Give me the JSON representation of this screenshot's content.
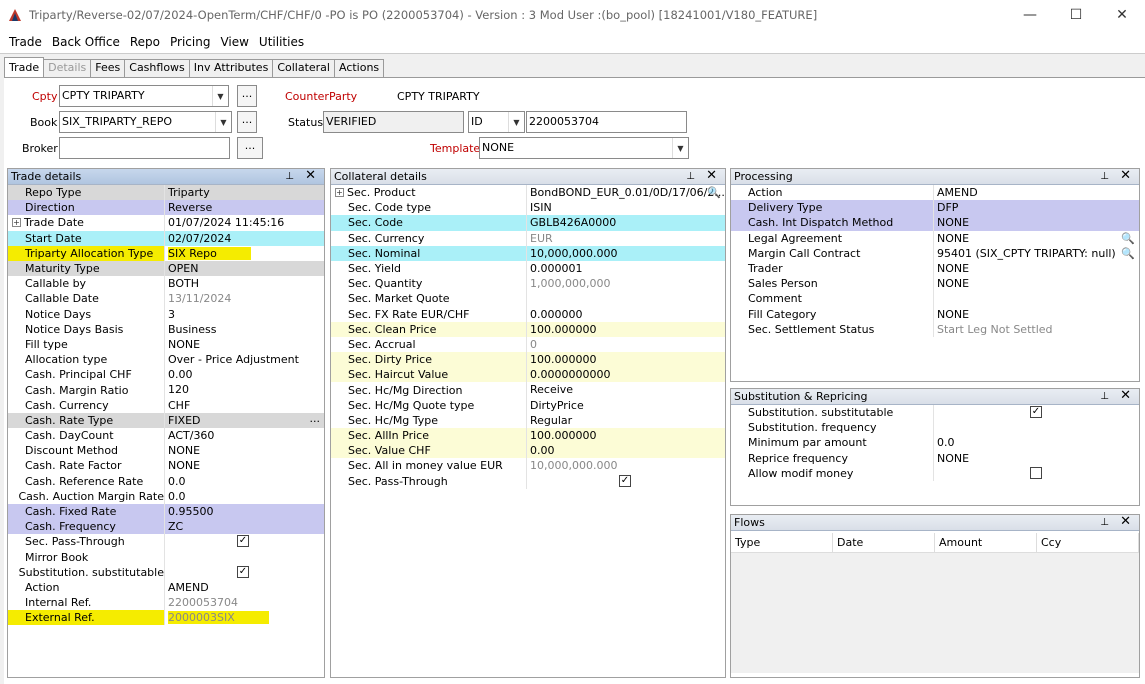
{
  "window": {
    "title": "Triparty/Reverse-02/07/2024-OpenTerm/CHF/CHF/0  -PO is PO  (2200053704) - Version : 3 Mod User :(bo_pool)  [18241001/V180_FEATURE]",
    "minimize": "—",
    "maximize": "☐",
    "close": "✕"
  },
  "menu": [
    "Trade",
    "Back Office",
    "Repo",
    "Pricing",
    "View",
    "Utilities"
  ],
  "tabs": [
    "Trade",
    "Details",
    "Fees",
    "Cashflows",
    "Inv Attributes",
    "Collateral",
    "Actions"
  ],
  "header": {
    "cpty_label": "Cpty",
    "cpty_value": "CPTY TRIPARTY",
    "counterparty_label": "CounterParty",
    "counterparty_value": "CPTY TRIPARTY",
    "book_label": "Book",
    "book_value": "SIX_TRIPARTY_REPO",
    "status_label": "Status",
    "status_value": "VERIFIED",
    "id_type": "ID",
    "id_value": "2200053704",
    "broker_label": "Broker",
    "broker_value": "",
    "template_label": "Template",
    "template_value": "NONE",
    "dots": "..."
  },
  "trade_details": {
    "title": "Trade details",
    "rows": [
      {
        "k": "Repo Type",
        "v": "Triparty",
        "style": "gry"
      },
      {
        "k": "Direction",
        "v": "Reverse",
        "style": "lav"
      },
      {
        "k": "Trade Date",
        "v": "01/07/2024 11:45:16",
        "style": "",
        "exp": true
      },
      {
        "k": "Start Date",
        "v": "02/07/2024",
        "style": "cyan"
      },
      {
        "k": "Triparty Allocation Type",
        "v": "SIX Repo",
        "style": "yhl"
      },
      {
        "k": "Maturity Type",
        "v": "OPEN",
        "style": "gry"
      },
      {
        "k": "Callable by",
        "v": "BOTH",
        "style": ""
      },
      {
        "k": "Callable Date",
        "v": "13/11/2024",
        "style": "",
        "dim": true
      },
      {
        "k": "Notice Days",
        "v": "3",
        "style": ""
      },
      {
        "k": "Notice Days Basis",
        "v": "Business",
        "style": ""
      },
      {
        "k": "Fill type",
        "v": "NONE",
        "style": ""
      },
      {
        "k": "Allocation type",
        "v": "Over - Price Adjustment",
        "style": ""
      },
      {
        "k": "Cash. Principal CHF",
        "v": "0.00",
        "style": ""
      },
      {
        "k": "Cash. Margin Ratio",
        "v": "120",
        "style": ""
      },
      {
        "k": "Cash. Currency",
        "v": "CHF",
        "style": ""
      },
      {
        "k": "Cash. Rate Type",
        "v": "FIXED",
        "style": "gry",
        "ell": "..."
      },
      {
        "k": "Cash. DayCount",
        "v": "ACT/360",
        "style": ""
      },
      {
        "k": "Discount Method",
        "v": "NONE",
        "style": ""
      },
      {
        "k": "Cash. Rate Factor",
        "v": "NONE",
        "style": ""
      },
      {
        "k": "Cash. Reference Rate",
        "v": "0.0",
        "style": ""
      },
      {
        "k": "Cash. Auction Margin Rate",
        "v": "0.0",
        "style": ""
      },
      {
        "k": "Cash. Fixed Rate",
        "v": "0.95500",
        "style": "lav"
      },
      {
        "k": "Cash. Frequency",
        "v": "ZC",
        "style": "lav"
      },
      {
        "k": "Sec. Pass-Through",
        "v": "",
        "style": "",
        "chk": "checked"
      },
      {
        "k": "Mirror Book",
        "v": "",
        "style": ""
      },
      {
        "k": "Substitution. substitutable",
        "v": "",
        "style": "",
        "chk": "checked"
      },
      {
        "k": "Action",
        "v": "AMEND",
        "style": ""
      },
      {
        "k": "Internal Ref.",
        "v": "2200053704",
        "style": "",
        "dim": true
      },
      {
        "k": "External Ref.",
        "v": "2000003SIX",
        "style": "yhl",
        "dim": true
      }
    ]
  },
  "collateral_details": {
    "title": "Collateral details",
    "rows": [
      {
        "k": "Sec. Product",
        "v": "BondBOND_EUR_0.01/0D/17/06/2...",
        "style": "",
        "exp": true,
        "mag": true
      },
      {
        "k": "Sec. Code type",
        "v": "ISIN",
        "style": ""
      },
      {
        "k": "Sec. Code",
        "v": "GBLB426A0000",
        "style": "cyan"
      },
      {
        "k": "Sec. Currency",
        "v": "EUR",
        "style": "",
        "dim": true
      },
      {
        "k": "Sec. Nominal",
        "v": "10,000,000.000",
        "style": "cyan"
      },
      {
        "k": "Sec. Yield",
        "v": "0.000001",
        "style": ""
      },
      {
        "k": "Sec. Quantity",
        "v": "1,000,000,000",
        "style": "",
        "dim": true
      },
      {
        "k": "Sec. Market Quote",
        "v": "",
        "style": ""
      },
      {
        "k": "Sec. FX Rate EUR/CHF",
        "v": "0.000000",
        "style": ""
      },
      {
        "k": "Sec. Clean Price",
        "v": "100.000000",
        "style": "cream"
      },
      {
        "k": "Sec. Accrual",
        "v": "0",
        "style": "",
        "dim": true
      },
      {
        "k": "Sec. Dirty Price",
        "v": "100.000000",
        "style": "cream"
      },
      {
        "k": "Sec. Haircut Value",
        "v": "0.0000000000",
        "style": "cream"
      },
      {
        "k": "Sec. Hc/Mg Direction",
        "v": "Receive",
        "style": ""
      },
      {
        "k": "Sec. Hc/Mg Quote type",
        "v": "DirtyPrice",
        "style": ""
      },
      {
        "k": "Sec. Hc/Mg Type",
        "v": "Regular",
        "style": ""
      },
      {
        "k": "Sec. AllIn Price",
        "v": "100.000000",
        "style": "cream"
      },
      {
        "k": "Sec. Value CHF",
        "v": "0.00",
        "style": "cream"
      },
      {
        "k": "Sec. All in money value EUR",
        "v": "10,000,000.000",
        "style": "",
        "dim": true
      },
      {
        "k": "Sec. Pass-Through",
        "v": "",
        "style": "",
        "chk": "checked"
      }
    ]
  },
  "processing": {
    "title": "Processing",
    "rows": [
      {
        "k": "Action",
        "v": "AMEND",
        "style": ""
      },
      {
        "k": "Delivery Type",
        "v": "DFP",
        "style": "lav"
      },
      {
        "k": "Cash. Int Dispatch Method",
        "v": "NONE",
        "style": "lav"
      },
      {
        "k": "Legal Agreement",
        "v": "NONE",
        "style": "",
        "mag": true
      },
      {
        "k": "Margin Call Contract",
        "v": "95401 (SIX_CPTY TRIPARTY: null)",
        "style": "",
        "mag": true
      },
      {
        "k": "Trader",
        "v": "NONE",
        "style": ""
      },
      {
        "k": "Sales Person",
        "v": "NONE",
        "style": ""
      },
      {
        "k": "Comment",
        "v": "",
        "style": ""
      },
      {
        "k": "Fill Category",
        "v": "NONE",
        "style": ""
      },
      {
        "k": "Sec. Settlement Status",
        "v": "Start Leg Not Settled",
        "style": "",
        "dim": true
      }
    ]
  },
  "substitution": {
    "title": "Substitution & Repricing",
    "rows": [
      {
        "k": "Substitution. substitutable",
        "v": "",
        "style": "",
        "chk": "checked"
      },
      {
        "k": "Substitution. frequency",
        "v": "",
        "style": ""
      },
      {
        "k": "Minimum par amount",
        "v": "0.0",
        "style": ""
      },
      {
        "k": "Reprice frequency",
        "v": "NONE",
        "style": ""
      },
      {
        "k": "Allow modif money",
        "v": "",
        "style": "",
        "chk": "unchecked"
      }
    ]
  },
  "flows": {
    "title": "Flows",
    "columns": [
      "Type",
      "Date",
      "Amount",
      "Ccy"
    ]
  },
  "panel_icons": {
    "pin": "📌",
    "close": "✕"
  }
}
